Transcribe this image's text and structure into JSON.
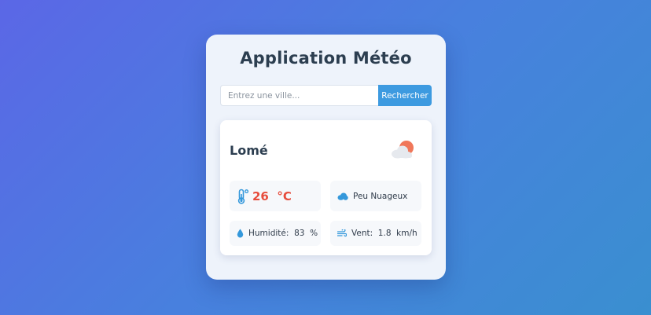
{
  "app": {
    "title": "Application Météo"
  },
  "search": {
    "placeholder": "Entrez une ville...",
    "value": "",
    "button_label": "Rechercher"
  },
  "weather": {
    "city": "Lomé",
    "icon": "partly-cloudy-icon",
    "temperature": {
      "value": "26",
      "unit": "°C",
      "display": "26  °C",
      "icon": "thermometer-icon"
    },
    "description": {
      "text": "Peu Nuageux",
      "icon": "cloud-icon"
    },
    "humidity": {
      "label": "Humidité:",
      "value": "83",
      "unit": "%",
      "display": "Humidité:  83  %",
      "icon": "water-drop-icon"
    },
    "wind": {
      "label": "Vent:",
      "value": "1.8",
      "unit": "km/h",
      "display": "Vent:  1.8  km/h",
      "icon": "wind-icon"
    }
  },
  "colors": {
    "background_start": "#5b67e6",
    "background_end": "#3a8fd0",
    "card": "#eef3fb",
    "title": "#2c3e50",
    "button": "#3d9ae0",
    "temperature": "#e74c3c",
    "icon_blue": "#3498db",
    "sun": "#f0775a",
    "cloud": "#e6e9ee"
  }
}
